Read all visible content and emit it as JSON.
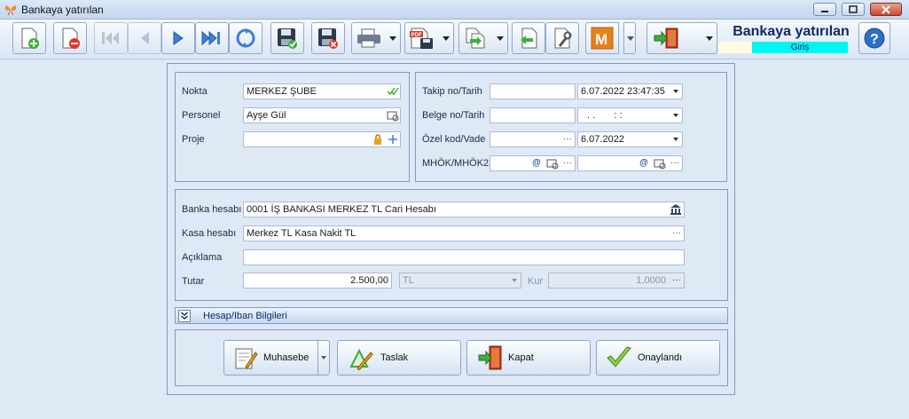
{
  "window": {
    "title": "Bankaya yatırılan"
  },
  "header": {
    "title": "Bankaya yatırılan",
    "subtitle": "Giriş"
  },
  "toolbar": {
    "buttons": [
      "new-document",
      "delete-document",
      "first-record",
      "previous-record",
      "next-record",
      "last-record",
      "refresh",
      "save",
      "save-close",
      "print",
      "pdf-export",
      "copy-export",
      "import-document",
      "settings",
      "m-module",
      "exit",
      "help"
    ]
  },
  "form": {
    "nokta_label": "Nokta",
    "nokta_value": "MERKEZ ŞUBE",
    "personel_label": "Personel",
    "personel_value": "Ayşe Gül",
    "proje_label": "Proje",
    "proje_value": "",
    "takip_label": "Takip no/Tarih",
    "takip_no": "",
    "takip_tarih": "6.07.2022 23:47:35",
    "belge_label": "Belge no/Tarih",
    "belge_no": "",
    "belge_tarih": ". .       : :",
    "ozel_label": "Özel kod/Vade",
    "ozel_kod": "",
    "vade": "6.07.2022",
    "mhok_label": "MHÖK/MHÖK2",
    "mhok1": "",
    "mhok2": "",
    "banka_label": "Banka hesabı",
    "banka_value": "0001 İŞ BANKASI MERKEZ TL Cari Hesabı",
    "kasa_label": "Kasa hesabı",
    "kasa_value": "Merkez TL Kasa Nakit TL",
    "aciklama_label": "Açıklama",
    "aciklama_value": "",
    "tutar_label": "Tutar",
    "tutar_value": "2.500,00",
    "currency_value": "TL",
    "kur_label": "Kur",
    "kur_value": "1,0000"
  },
  "section": {
    "hesap_iban": "Hesap/Iban Bilgileri"
  },
  "actions": {
    "muhasebe": "Muhasebe",
    "taslak": "Taslak",
    "kapat": "Kapat",
    "onaylandi": "Onaylandı"
  },
  "colors": {
    "accent": "#00f6f2",
    "brand": "#0f2a6b",
    "close": "#c44a35"
  }
}
